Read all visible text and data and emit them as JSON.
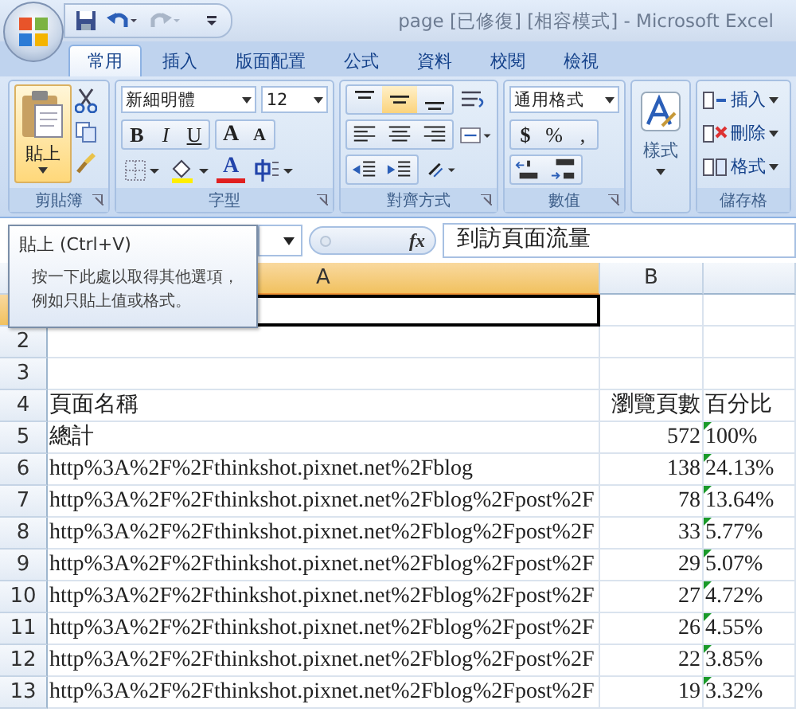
{
  "title_bar": {
    "title": "page [已修復]  [相容模式] - Microsoft Excel"
  },
  "tabs": [
    {
      "label": "常用",
      "selected": true
    },
    {
      "label": "插入",
      "selected": false
    },
    {
      "label": "版面配置",
      "selected": false
    },
    {
      "label": "公式",
      "selected": false
    },
    {
      "label": "資料",
      "selected": false
    },
    {
      "label": "校閱",
      "selected": false
    },
    {
      "label": "檢視",
      "selected": false
    }
  ],
  "ribbon": {
    "clipboard": {
      "paste": "貼上",
      "paste_highlighted": true,
      "label": "剪貼簿"
    },
    "font": {
      "name": "新細明體",
      "size": "12",
      "bold": "B",
      "italic": "I",
      "underline": "U",
      "grow": "A",
      "shrink": "A",
      "font_color": "A",
      "label": "字型"
    },
    "alignment": {
      "vertical": [
        {
          "kind": "top",
          "selected": false
        },
        {
          "kind": "middle",
          "selected": true
        },
        {
          "kind": "bottom",
          "selected": false
        }
      ],
      "label": "對齊方式"
    },
    "number": {
      "format": "通用格式",
      "currency": "$",
      "percent": "%",
      "comma": ",",
      "label": "數值"
    },
    "styles": {
      "label": "樣式"
    },
    "cells": {
      "items": [
        {
          "kind": "insert",
          "label": "插入"
        },
        {
          "kind": "delete",
          "label": "刪除"
        },
        {
          "kind": "format",
          "label": "格式"
        }
      ],
      "label": "儲存格"
    }
  },
  "tooltip": {
    "title": "貼上 (Ctrl+V)",
    "body": "按一下此處以取得其他選項，例如只貼上值或格式。"
  },
  "formula_bar": {
    "function_symbol": "fx",
    "value": "到訪頁面流量"
  },
  "sheet": {
    "columns": [
      {
        "label": "A",
        "selected": true
      },
      {
        "label": "B",
        "selected": false
      }
    ],
    "rows": [
      {
        "selected": true,
        "active_cell": true
      },
      {
        "number": "2",
        "selected": false,
        "active_cell": false
      },
      {
        "number": "3",
        "selected": false,
        "active_cell": false
      },
      {
        "number": "4",
        "selected": false,
        "active_cell": false,
        "a": "頁面名稱",
        "b": "瀏覽頁數",
        "c": "百分比"
      },
      {
        "number": "5",
        "selected": false,
        "active_cell": false,
        "a": "總計",
        "b": "572",
        "c": "100%",
        "error_flag": true
      },
      {
        "number": "6",
        "selected": false,
        "active_cell": false,
        "a": "http%3A%2F%2Fthinkshot.pixnet.net%2Fblog",
        "b": "138",
        "c": "24.13%",
        "error_flag": true
      },
      {
        "number": "7",
        "selected": false,
        "active_cell": false,
        "a": "http%3A%2F%2Fthinkshot.pixnet.net%2Fblog%2Fpost%2F",
        "b": "78",
        "c": "13.64%",
        "error_flag": true
      },
      {
        "number": "8",
        "selected": false,
        "active_cell": false,
        "a": "http%3A%2F%2Fthinkshot.pixnet.net%2Fblog%2Fpost%2F",
        "b": "33",
        "c": "5.77%",
        "error_flag": true
      },
      {
        "number": "9",
        "selected": false,
        "active_cell": false,
        "a": "http%3A%2F%2Fthinkshot.pixnet.net%2Fblog%2Fpost%2F",
        "b": "29",
        "c": "5.07%",
        "error_flag": true
      },
      {
        "number": "10",
        "selected": false,
        "active_cell": false,
        "a": "http%3A%2F%2Fthinkshot.pixnet.net%2Fblog%2Fpost%2F",
        "b": "27",
        "c": "4.72%",
        "error_flag": true
      },
      {
        "number": "11",
        "selected": false,
        "active_cell": false,
        "a": "http%3A%2F%2Fthinkshot.pixnet.net%2Fblog%2Fpost%2F",
        "b": "26",
        "c": "4.55%",
        "error_flag": true
      },
      {
        "number": "12",
        "selected": false,
        "active_cell": false,
        "a": "http%3A%2F%2Fthinkshot.pixnet.net%2Fblog%2Fpost%2F",
        "b": "22",
        "c": "3.85%",
        "error_flag": true
      },
      {
        "number": "13",
        "selected": false,
        "active_cell": false,
        "a": "http%3A%2F%2Fthinkshot.pixnet.net%2Fblog%2Fpost%2F",
        "b": "19",
        "c": "3.32%",
        "error_flag": true
      }
    ]
  }
}
